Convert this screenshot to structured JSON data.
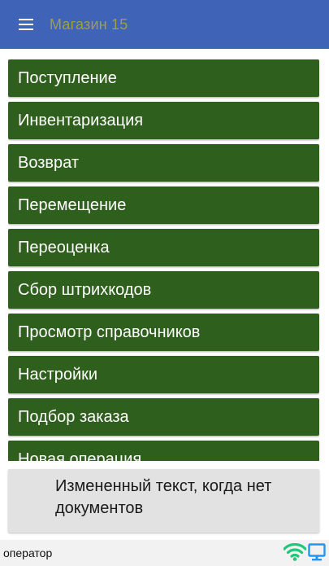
{
  "header": {
    "title": "Магазин 15",
    "menu_icon": "hamburger-menu-icon"
  },
  "menu": {
    "items": [
      {
        "label": "Поступление"
      },
      {
        "label": "Инвентаризация"
      },
      {
        "label": "Возврат"
      },
      {
        "label": "Перемещение"
      },
      {
        "label": "Переоценка"
      },
      {
        "label": "Сбор штрихкодов"
      },
      {
        "label": "Просмотр справочников"
      },
      {
        "label": "Настройки"
      },
      {
        "label": "Подбор заказа"
      },
      {
        "label": "Новая операция"
      }
    ]
  },
  "message": {
    "text": "Измененный текст, когда нет документов"
  },
  "status": {
    "user": "оператор",
    "wifi_icon": "wifi-icon",
    "monitor_icon": "monitor-icon"
  },
  "colors": {
    "appbar": "#3f63b6",
    "title": "#a0a042",
    "menu_item": "#2f5f1d",
    "message_bg": "#e2e2e2",
    "wifi": "#1fc77a",
    "monitor": "#2196f3"
  }
}
